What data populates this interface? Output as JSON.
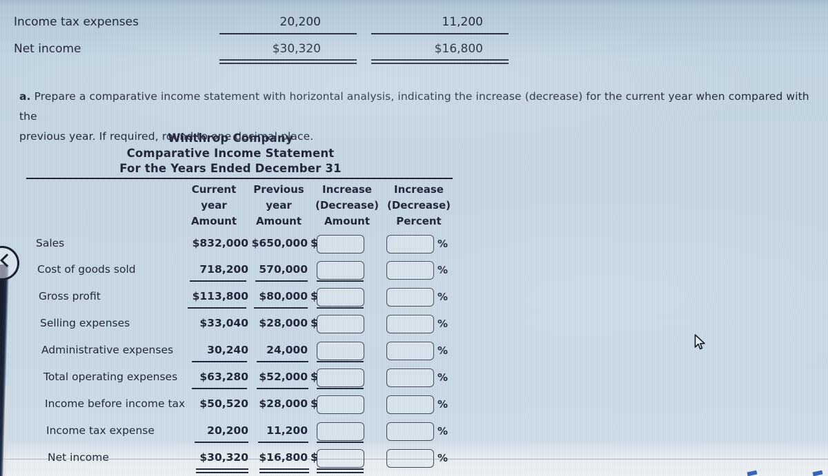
{
  "top_fragment": {
    "rows": [
      {
        "label": "Income tax expenses",
        "current": "20,200",
        "previous": "11,200"
      },
      {
        "label": "Net income",
        "current": "$30,320",
        "previous": "$16,800"
      }
    ]
  },
  "instructions": {
    "lead": "a.",
    "line1": "Prepare a comparative income statement with horizontal analysis, indicating the increase (decrease) for the current year when compared with the",
    "line2": "previous year. If required, round to one decimal place."
  },
  "statement": {
    "company": "Winthrop Company",
    "title": "Comparative Income Statement",
    "period": "For the Years Ended December 31",
    "columns": [
      {
        "line1": "Current",
        "line2": "year",
        "line3": "Amount"
      },
      {
        "line1": "Previous",
        "line2": "year",
        "line3": "Amount"
      },
      {
        "line1": "Increase",
        "line2": "(Decrease)",
        "line3": "Amount"
      },
      {
        "line1": "Increase",
        "line2": "(Decrease)",
        "line3": "Percent"
      }
    ],
    "percent_symbol": "%",
    "dollar_symbol": "$",
    "rows": [
      {
        "label": "Sales",
        "current": "$832,000",
        "previous": "$650,000",
        "dollar": true,
        "increase_value": "",
        "percent_value": ""
      },
      {
        "label": "Cost of goods sold",
        "current": "718,200",
        "previous": "570,000",
        "dollar": false,
        "increase_value": "",
        "percent_value": ""
      },
      {
        "label": "Gross profit",
        "current": "$113,800",
        "previous": "$80,000",
        "dollar": true,
        "increase_value": "",
        "percent_value": ""
      },
      {
        "label": "Selling expenses",
        "current": "$33,040",
        "previous": "$28,000",
        "dollar": true,
        "increase_value": "",
        "percent_value": ""
      },
      {
        "label": "Administrative expenses",
        "current": "30,240",
        "previous": "24,000",
        "dollar": false,
        "increase_value": "",
        "percent_value": ""
      },
      {
        "label": "Total operating expenses",
        "current": "$63,280",
        "previous": "$52,000",
        "dollar": true,
        "increase_value": "",
        "percent_value": ""
      },
      {
        "label": "Income before income tax",
        "current": "$50,520",
        "previous": "$28,000",
        "dollar": true,
        "increase_value": "",
        "percent_value": ""
      },
      {
        "label": "Income tax expense",
        "current": "20,200",
        "previous": "11,200",
        "dollar": false,
        "increase_value": "",
        "percent_value": ""
      },
      {
        "label": "Net income",
        "current": "$30,320",
        "previous": "$16,800",
        "dollar": true,
        "increase_value": "",
        "percent_value": ""
      }
    ]
  },
  "controls": {
    "back_button_label": "Previous"
  },
  "colors": {
    "screen_background": "#c8d8e5",
    "text": "#1b2235",
    "rule": "#1b2438",
    "field_border": "#3c4658",
    "bezel": "#0d1426"
  }
}
